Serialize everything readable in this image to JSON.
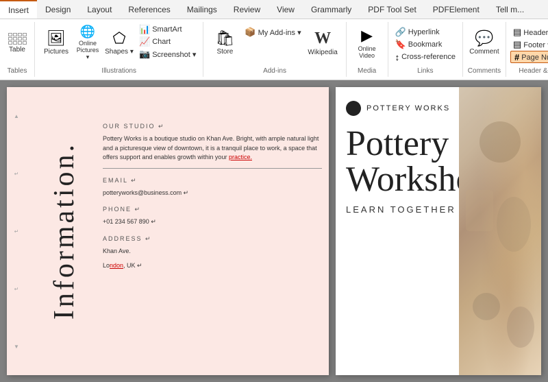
{
  "tabs": {
    "items": [
      {
        "label": "Insert",
        "active": true
      },
      {
        "label": "Design"
      },
      {
        "label": "Layout"
      },
      {
        "label": "References"
      },
      {
        "label": "Mailings"
      },
      {
        "label": "Review"
      },
      {
        "label": "View"
      },
      {
        "label": "Grammarly"
      },
      {
        "label": "PDF Tool Set"
      },
      {
        "label": "PDFElement"
      },
      {
        "label": "Tell m..."
      }
    ]
  },
  "ribbon": {
    "groups": [
      {
        "name": "Tables",
        "label": "Tables",
        "buttons": [
          {
            "label": "Table",
            "type": "table"
          }
        ]
      },
      {
        "name": "Illustrations",
        "label": "Illustrations",
        "buttons": [
          {
            "label": "Pictures",
            "icon": "🖼"
          },
          {
            "label": "Online\nPictures",
            "icon": "🌐"
          },
          {
            "label": "Shapes",
            "icon": "⬠"
          },
          {
            "label": "SmartArt",
            "icon": "📊"
          },
          {
            "label": "Chart",
            "icon": "📈"
          },
          {
            "label": "Screenshot",
            "icon": "📷"
          }
        ]
      },
      {
        "name": "Add-ins",
        "label": "Add-ins",
        "buttons": [
          {
            "label": "Store",
            "icon": "🛍"
          },
          {
            "label": "My Add-ins",
            "icon": "📦"
          },
          {
            "label": "Wikipedia",
            "icon": "W"
          }
        ]
      },
      {
        "name": "Media",
        "label": "Media",
        "buttons": [
          {
            "label": "Online\nVideo",
            "icon": "▶"
          }
        ]
      },
      {
        "name": "Links",
        "label": "Links",
        "buttons": [
          {
            "label": "Hyperlink",
            "icon": "🔗"
          },
          {
            "label": "Bookmark",
            "icon": "🔖"
          },
          {
            "label": "Cross-reference",
            "icon": "↕"
          }
        ]
      },
      {
        "name": "Comments",
        "label": "Comments",
        "buttons": [
          {
            "label": "Comment",
            "icon": "💬"
          }
        ]
      },
      {
        "name": "Header & Footer",
        "label": "Header & Footer",
        "buttons": [
          {
            "label": "Header",
            "icon": "▤",
            "dropdown": true
          },
          {
            "label": "Footer",
            "icon": "▤",
            "dropdown": true
          },
          {
            "label": "Page Number",
            "icon": "#",
            "dropdown": true,
            "highlighted": true
          }
        ]
      }
    ]
  },
  "document": {
    "left_page": {
      "vertical_text": "Information.",
      "section_our_studio": {
        "title": "OUR STUDIO ↵",
        "body": "Pottery Works is a boutique studio on Khan Ave. Bright, with ample natural light and a picturesque view of downtown, it is a tranquil place to work, a space that offers support and enables growth within your practice."
      },
      "section_email": {
        "title": "EMAIL ↵",
        "value": "potteryworks@business.com ↵"
      },
      "section_phone": {
        "title": "PHONE ↵",
        "value": "+01 234 567 890 ↵"
      },
      "section_address": {
        "title": "ADDRESS ↵",
        "value1": "Khan Ave.",
        "value2": "London, UK ↵"
      }
    },
    "right_page": {
      "logo_text": "POTTERY WORKS",
      "title_line1": "Pottery",
      "title_line2": "Worksho",
      "subtitle": "LEARN TOGETHER"
    }
  }
}
